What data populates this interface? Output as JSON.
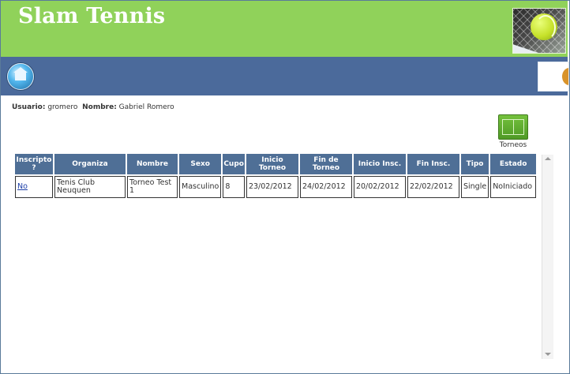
{
  "header": {
    "title": "Slam Tennis"
  },
  "user": {
    "usuario_label": "Usuario:",
    "usuario_value": "gromero",
    "nombre_label": "Nombre:",
    "nombre_value": "Gabriel Romero"
  },
  "shortcuts": {
    "torneos_label": "Torneos"
  },
  "table": {
    "headers": [
      "Inscripto ?",
      "Organiza",
      "Nombre",
      "Sexo",
      "Cupo",
      "Inicio Torneo",
      "Fin de Torneo",
      "Inicio Insc.",
      "Fin Insc.",
      "Tipo",
      "Estado"
    ],
    "rows": [
      {
        "inscripto": "No",
        "organiza": "Tenis Club Neuquen",
        "nombre": "Torneo Test 1",
        "sexo": "Masculino",
        "cupo": "8",
        "inicio_torneo": "23/02/2012",
        "fin_torneo": "24/02/2012",
        "inicio_insc": "20/02/2012",
        "fin_insc": "22/02/2012",
        "tipo": "Single",
        "estado": "NoIniciado"
      }
    ]
  },
  "colors": {
    "header_green": "#90d25a",
    "nav_blue": "#4b6a9b",
    "table_header": "#4f6f96",
    "link": "#1d3fa8"
  },
  "icons": {
    "home": "home-icon",
    "torneos": "tennis-court-icon",
    "logo": "tennis-ball-image"
  }
}
